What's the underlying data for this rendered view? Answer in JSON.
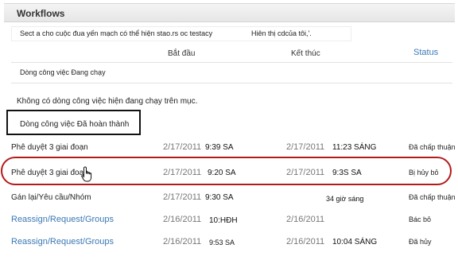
{
  "header": {
    "title": "Workflows"
  },
  "start_bar": {
    "start_text": "Sect a cho cuộc đua yến mạch có thể hiện stao.rs oc testacy",
    "show_text": "Hiên thị cdcủa tôi,'."
  },
  "columns": {
    "started": "Bắt đầu",
    "ended": "Kết thúc",
    "status": "Status"
  },
  "running": {
    "label": "Dòng công việc Đang chạy",
    "empty_text": "Không có dòng công việc hiện đang chạy trên mục."
  },
  "completed": {
    "label": "Dòng công việc Đã hoàn thành",
    "rows": [
      {
        "name": "Phê duyệt 3 giai đoạn",
        "link": false,
        "start_date": "2/17/2011",
        "start_time": "9:39 SA",
        "end_date": "2/17/2011",
        "end_time": "11:23 SÁNG",
        "status": "Đã chấp thuận"
      },
      {
        "name": "Phê duyệt 3 giai đoạn",
        "link": false,
        "start_date": "2/17/2011",
        "start_time": "9:20 SA",
        "end_date": "2/17/2011",
        "end_time": "9:3S SA",
        "status": "Bị hủy bỏ"
      },
      {
        "name": "Gán lại/Yêu cầu/Nhóm",
        "link": false,
        "start_date": "2/17/2011",
        "start_time": "9:30 SA",
        "end_date": "",
        "end_time": "34 giờ sáng",
        "status": "Đã chấp thuận"
      },
      {
        "name": "Reassign/Request/Groups",
        "link": true,
        "start_date": "2/16/2011",
        "start_time": "10:HĐH",
        "end_date": "2/16/2011",
        "end_time": "",
        "status": "Bác bỏ"
      },
      {
        "name": "Reassign/Request/Groups",
        "link": true,
        "start_date": "2/16/2011",
        "start_time": "9:53 SA",
        "end_date": "2/16/2011",
        "end_time": "10:04 SÁNG",
        "status": "Đã hủy"
      }
    ]
  },
  "colors": {
    "link": "#3a79b5",
    "highlight": "#b31b1b"
  },
  "icons": {
    "cursor": "hand-pointer-icon"
  }
}
